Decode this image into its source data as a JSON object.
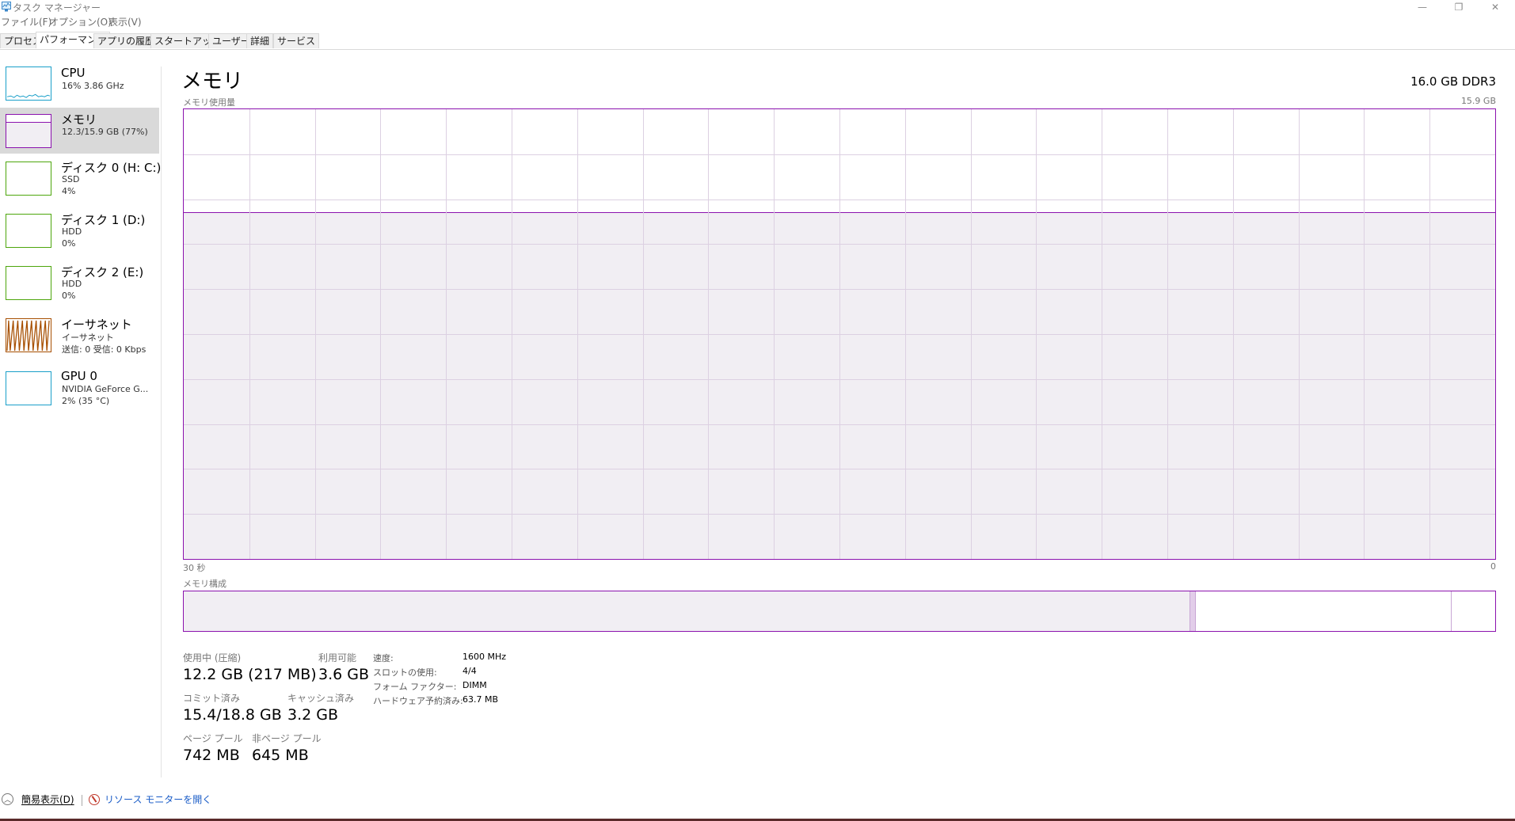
{
  "window": {
    "title": "タスク マネージャー",
    "controls": [
      "—",
      "❐",
      "✕"
    ]
  },
  "menu": [
    "ファイル(F)",
    "オプション(O)",
    "表示(V)"
  ],
  "tabs": [
    {
      "label": "プロセス",
      "active": false
    },
    {
      "label": "パフォーマンス",
      "active": true
    },
    {
      "label": "アプリの履歴",
      "active": false
    },
    {
      "label": "スタートアップ",
      "active": false
    },
    {
      "label": "ユーザー",
      "active": false
    },
    {
      "label": "詳細",
      "active": false
    },
    {
      "label": "サービス",
      "active": false
    }
  ],
  "sidebar": {
    "items": [
      {
        "title": "CPU",
        "line1": "16%  3.86 GHz",
        "line2": "",
        "color": "#1a9fc9",
        "selected": false
      },
      {
        "title": "メモリ",
        "line1": "12.3/15.9 GB (77%)",
        "line2": "",
        "color": "#8b12ae",
        "selected": true
      },
      {
        "title": "ディスク 0 (H: C:)",
        "line1": "SSD",
        "line2": "4%",
        "color": "#4da60c",
        "selected": false
      },
      {
        "title": "ディスク 1 (D:)",
        "line1": "HDD",
        "line2": "0%",
        "color": "#4da60c",
        "selected": false
      },
      {
        "title": "ディスク 2 (E:)",
        "line1": "HDD",
        "line2": "0%",
        "color": "#4da60c",
        "selected": false
      },
      {
        "title": "イーサネット",
        "line1": "イーサネット",
        "line2": "送信: 0 受信: 0 Kbps",
        "color": "#a74f01",
        "selected": false
      },
      {
        "title": "GPU 0",
        "line1": "NVIDIA GeForce G...",
        "line2": "2% (35 °C)",
        "color": "#1a9fc9",
        "selected": false
      }
    ]
  },
  "main": {
    "title": "メモリ",
    "spec": "16.0 GB DDR3",
    "usage_graph": {
      "label": "メモリ使用量",
      "max_label": "15.9 GB",
      "time_left": "30 秒",
      "time_right": "0",
      "used_fraction": 0.77,
      "line_color": "#8b12ae",
      "fill_color": "#f1eef3"
    },
    "composition": {
      "label": "メモリ構成",
      "in_use_fraction": 0.767,
      "modified_fraction": 0.004,
      "standby_fraction": 0.195,
      "free_fraction": 0.034
    },
    "stats": {
      "in_use_label": "使用中 (圧縮)",
      "in_use_value": "12.2 GB (217 MB)",
      "available_label": "利用可能",
      "available_value": "3.6 GB",
      "committed_label": "コミット済み",
      "committed_value": "15.4/18.8 GB",
      "cached_label": "キャッシュ済み",
      "cached_value": "3.2 GB",
      "paged_label": "ページ プール",
      "paged_value": "742 MB",
      "nonpaged_label": "非ページ プール",
      "nonpaged_value": "645 MB"
    },
    "details": [
      {
        "key": "速度:",
        "value": "1600 MHz"
      },
      {
        "key": "スロットの使用:",
        "value": "4/4"
      },
      {
        "key": "フォーム ファクター:",
        "value": "DIMM"
      },
      {
        "key": "ハードウェア予約済み:",
        "value": "63.7 MB"
      }
    ]
  },
  "footer": {
    "fewer_details": "簡易表示(D)",
    "resource_monitor": "リソース モニターを開く"
  }
}
